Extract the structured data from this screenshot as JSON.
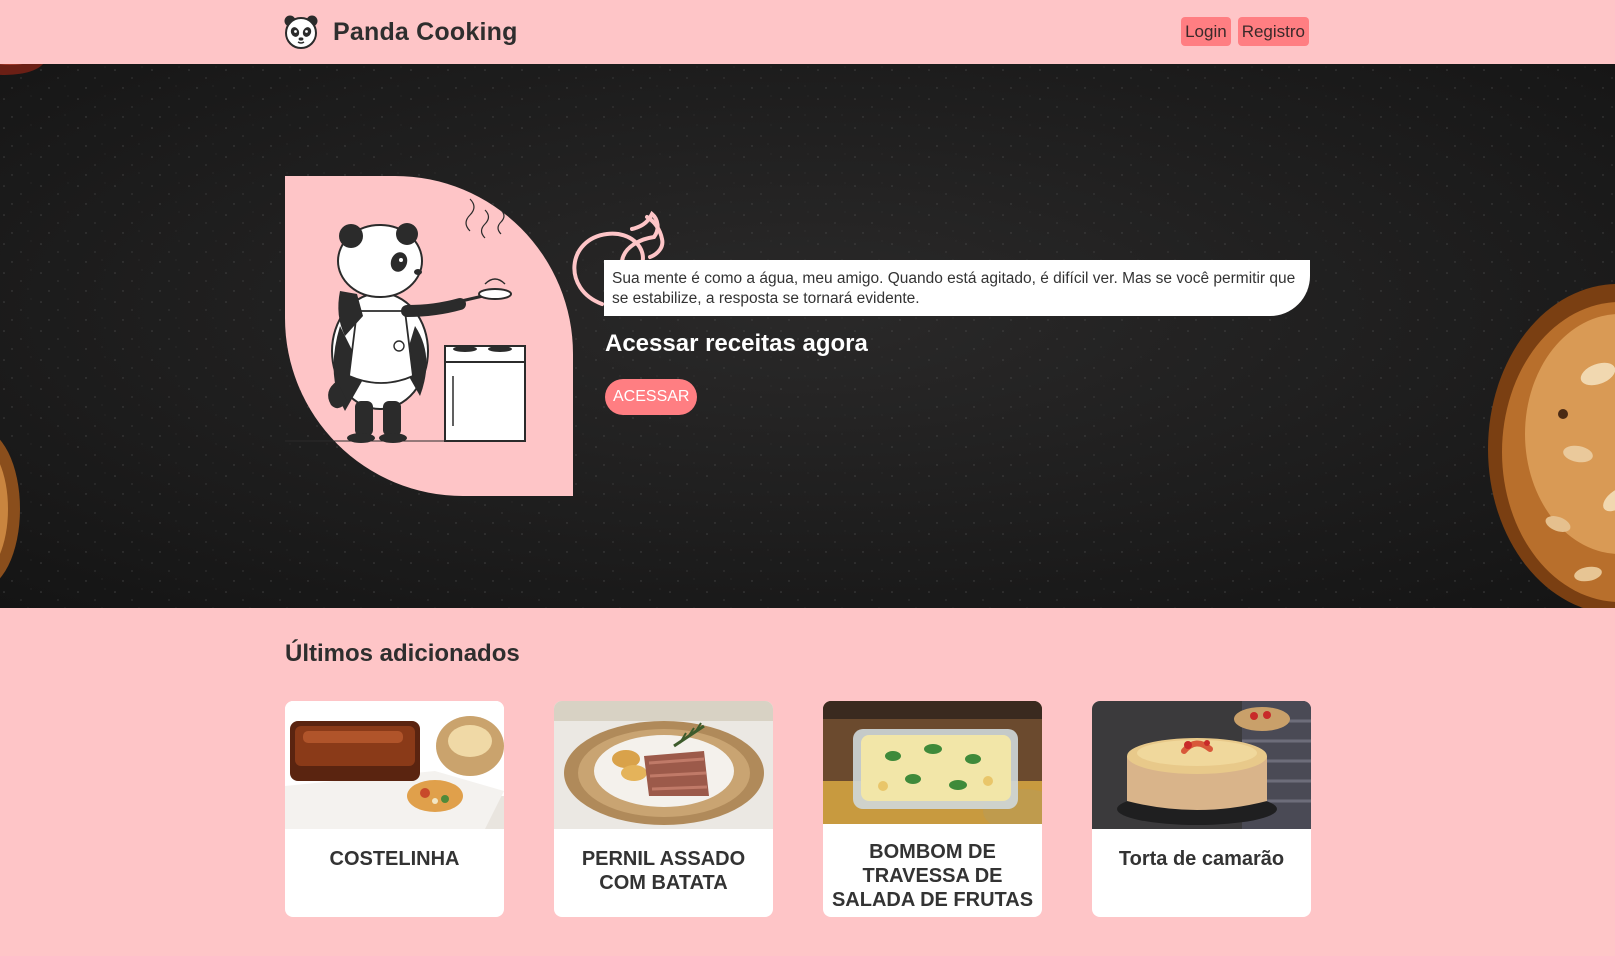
{
  "header": {
    "brand": "Panda Cooking",
    "login_label": "Login",
    "register_label": "Registro"
  },
  "hero": {
    "quote": "Sua mente é como a água, meu amigo. Quando está agitado, é difícil ver. Mas se você permitir que se estabilize, a resposta se tornará evidente.",
    "heading": "Acessar receitas agora",
    "button_label": "ACESSAR"
  },
  "recent": {
    "title": "Últimos adicionados",
    "items": [
      {
        "title": "COSTELINHA",
        "image": "ribs-with-baked-potato"
      },
      {
        "title": "PERNIL ASSADO COM BATATA",
        "image": "sliced-pork-with-potatoes"
      },
      {
        "title": "BOMBOM DE TRAVESSA DE SALADA DE FRUTAS",
        "image": "fruit-salad-dessert-dish"
      },
      {
        "title": "Torta de camarão",
        "image": "shrimp-pie"
      }
    ]
  },
  "icons": {
    "logo": "panda-face-icon",
    "hero": "panda-chef-cooking-illustration",
    "steam": "steam-swirl-decoration"
  },
  "colors": {
    "page_background": "#fec5c7",
    "accent": "#ff7e82",
    "hero_background": "#1d1c1c",
    "card_background": "#ffffff",
    "text_dark": "#2e2e2e"
  }
}
